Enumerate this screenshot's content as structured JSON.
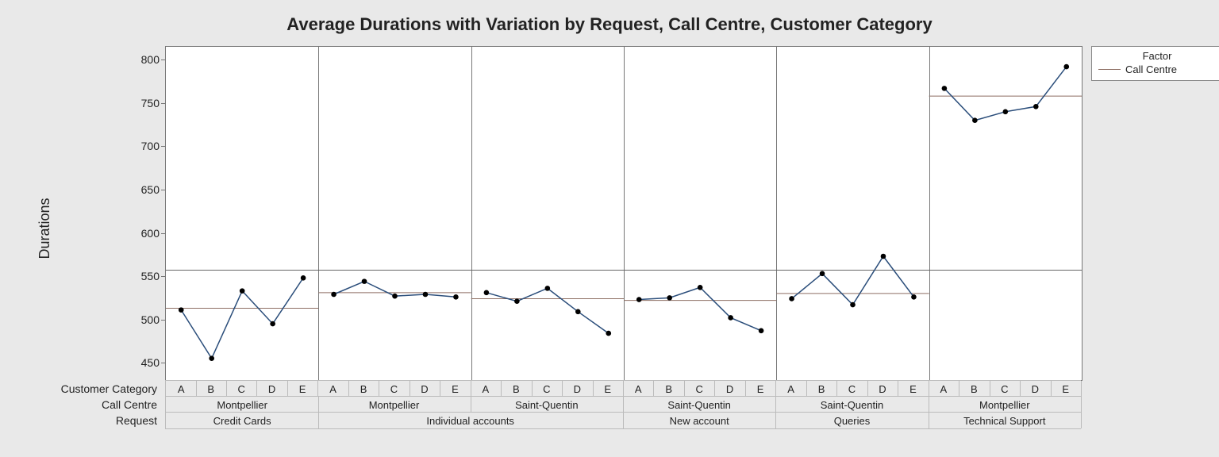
{
  "title": "Average Durations with Variation by Request, Call Centre, Customer Category",
  "ylabel": "Durations",
  "axis_headers": {
    "cat": "Customer Category",
    "centre": "Call Centre",
    "request": "Request"
  },
  "legend": {
    "title": "Factor",
    "item": "Call Centre"
  },
  "chart_data": {
    "type": "line",
    "ylim": [
      430,
      815
    ],
    "yticks": [
      450,
      500,
      550,
      600,
      650,
      700,
      750,
      800
    ],
    "categories": [
      "A",
      "B",
      "C",
      "D",
      "E"
    ],
    "grand_mean": 557,
    "panels": [
      {
        "request": "Credit Cards",
        "centre": "Montpellier",
        "factor_mean": 513,
        "values": [
          511,
          455,
          533,
          495,
          548
        ]
      },
      {
        "request": "Individual accounts",
        "centre": "Montpellier",
        "factor_mean": 531,
        "values": [
          529,
          544,
          527,
          529,
          526
        ]
      },
      {
        "request": "Individual accounts",
        "centre": "Saint-Quentin",
        "factor_mean": 524,
        "values": [
          531,
          521,
          536,
          509,
          484
        ]
      },
      {
        "request": "New account",
        "centre": "Saint-Quentin",
        "factor_mean": 522,
        "values": [
          523,
          525,
          537,
          502,
          487
        ]
      },
      {
        "request": "Queries",
        "centre": "Saint-Quentin",
        "factor_mean": 530,
        "values": [
          524,
          553,
          517,
          573,
          526
        ]
      },
      {
        "request": "Technical Support",
        "centre": "Montpellier",
        "factor_mean": 758,
        "values": [
          767,
          730,
          740,
          746,
          792
        ]
      }
    ],
    "request_groups": [
      {
        "label": "Credit Cards",
        "span": 1
      },
      {
        "label": "Individual accounts",
        "span": 2
      },
      {
        "label": "New account",
        "span": 1
      },
      {
        "label": "Queries",
        "span": 1
      },
      {
        "label": "Technical Support",
        "span": 1
      }
    ]
  }
}
